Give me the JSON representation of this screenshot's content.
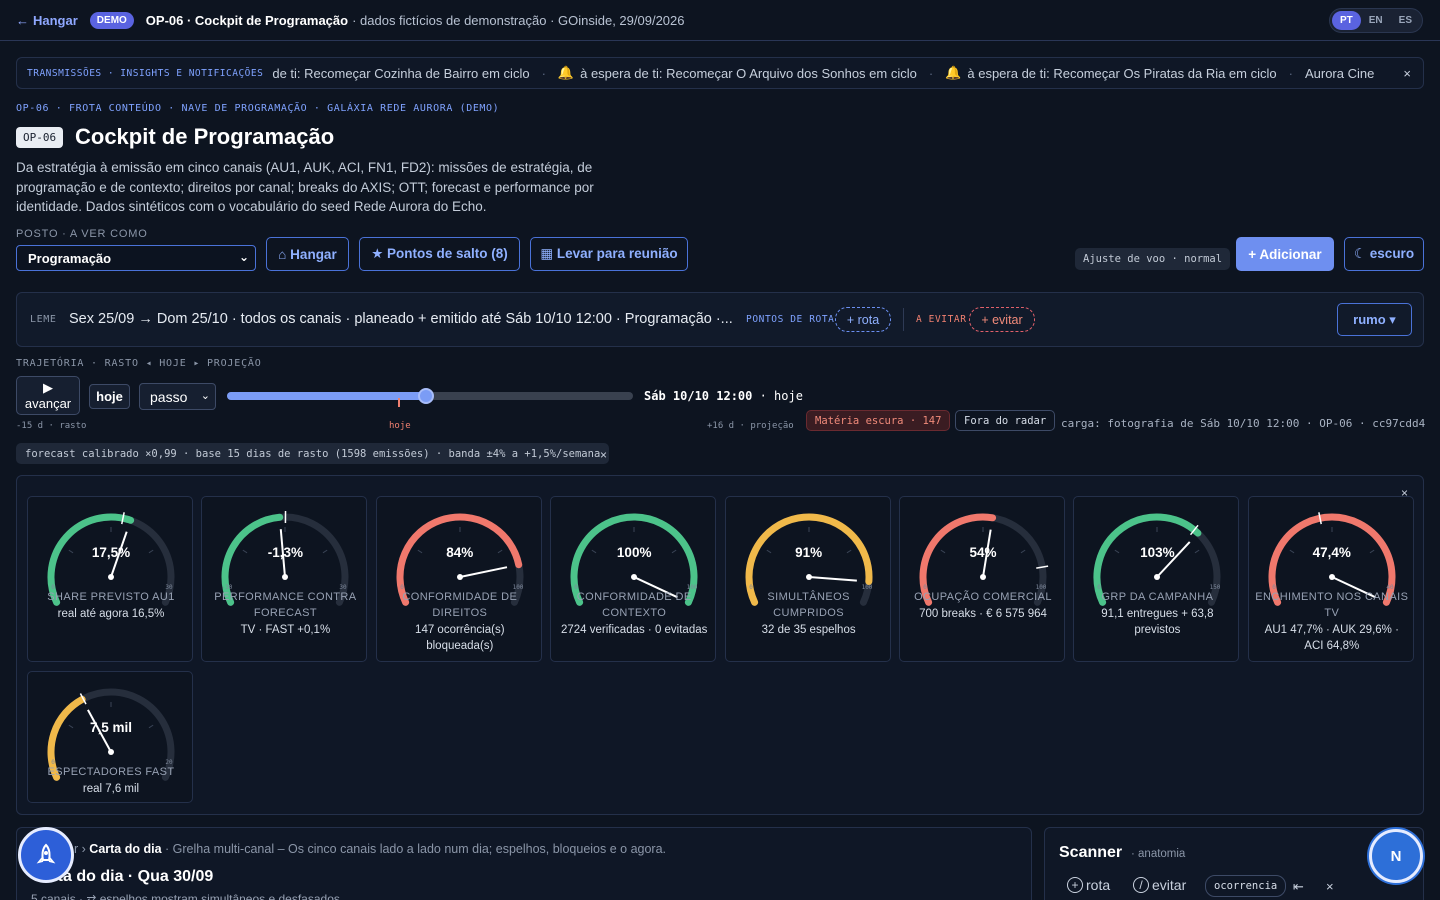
{
  "topbar": {
    "back_label": "Hangar",
    "demo_badge": "DEMO",
    "title": "OP-06 · Cockpit de Programação",
    "subtitle": "· dados fictícios de demonstração · GOinside, 29/09/2026",
    "languages": [
      "PT",
      "EN",
      "ES"
    ],
    "active_language": "PT"
  },
  "ticker": {
    "label": "TRANSMISSÕES · INSIGHTS E NOTIFICAÇÕES",
    "items": [
      "de ti: Recomeçar Cozinha de Bairro em ciclo",
      "à espera de ti: Recomeçar O Arquivo dos Sonhos em ciclo",
      "à espera de ti: Recomeçar Os Piratas da Ria em ciclo",
      "Aurora Cine"
    ],
    "close": "×"
  },
  "breadcrumb": "OP-06 · FROTA CONTEÚDO · NAVE DE PROGRAMAÇÃO · GALÁXIA REDE AURORA (DEMO)",
  "page": {
    "code": "OP-06",
    "title": "Cockpit de Programação",
    "description": "Da estratégia à emissão em cinco canais (AU1, AUK, ACI, FN1, FD2): missões de estratégia, de programação e de contexto; direitos por canal; breaks do AXIS; OTT; forecast e performance por identidade. Dados sintéticos com o vocabulário do seed Rede Aurora do Echo."
  },
  "posto": {
    "label": "POSTO · A VER COMO",
    "value": "Programação"
  },
  "actions": {
    "hangar": "⌂ Hangar",
    "jump_points": "★ Pontos de salto (8)",
    "meeting": "▦ Levar para reunião",
    "flight_adjust": "Ajuste de voo · normal",
    "add": "+ Adicionar",
    "theme": "☾ escuro"
  },
  "leme": {
    "label": "LEME",
    "text": "Sex 25/09 → Dom 25/10 · todos os canais · planeado + emitido até Sáb 10/10 12:00 · Programação ·...",
    "waypoints_label": "PONTOS DE ROTA",
    "add_route": "+ rota",
    "avoid_label": "A EVITAR",
    "add_avoid": "+ evitar",
    "heading": "rumo ▾"
  },
  "trajectory": {
    "label": "TRAJETÓRIA · RASTO ◂ HOJE ▸ PROJEÇÃO",
    "advance_icon": "▶",
    "advance": "avançar",
    "today_button": "hoje",
    "step": "passo",
    "slider_fraction": 0.49,
    "readout_time": "Sáb 10/10 12:00",
    "readout_suffix": "· hoje",
    "tick_left": "-15 d · rasto",
    "tick_today": "hoje",
    "tick_right": "+16 d · projeção",
    "dark_matter": "Matéria escura · 147",
    "off_radar": "Fora do radar",
    "load": "carga: fotografia de Sáb 10/10 12:00 · OP-06 · cc97cdd4",
    "forecast": "forecast calibrado ×0,99 · base 15 dias de rasto (1598 emissões) · banda ±4% a +1,5%/semana",
    "forecast_close": "×"
  },
  "gauges": [
    {
      "value": "17,5%",
      "label": "SHARE PREVISTO AU1",
      "sub": "real até agora 16,5%",
      "min": "0",
      "max": "30",
      "fraction": 0.583,
      "marker": 0.55,
      "color": "#4cc38a"
    },
    {
      "value": "-1,3%",
      "label": "PERFORMANCE CONTRA FORECAST",
      "sub": "TV · FAST +0,1%",
      "min": "-30",
      "max": "30",
      "fraction": 0.478,
      "marker": 0.502,
      "color": "#4cc38a"
    },
    {
      "value": "84%",
      "label": "CONFORMIDADE DE DIREITOS",
      "sub": "147 ocorrência(s) bloqueada(s)",
      "min": "0",
      "max": "100",
      "fraction": 0.84,
      "marker": null,
      "color": "#f0786c"
    },
    {
      "value": "100%",
      "label": "CONFORMIDADE DE CONTEXTO",
      "sub": "2724 verificadas · 0 evitadas",
      "min": "0",
      "max": "100",
      "fraction": 1.0,
      "marker": null,
      "color": "#4cc38a"
    },
    {
      "value": "91%",
      "label": "SIMULTÂNEOS CUMPRIDOS",
      "sub": "32 de 35 espelhos",
      "min": "0",
      "max": "100",
      "fraction": 0.91,
      "marker": null,
      "color": "#f0b94a"
    },
    {
      "value": "54%",
      "label": "OCUPAÇÃO COMERCIAL",
      "sub": "700 breaks · € 6 575 964",
      "min": "0",
      "max": "100",
      "fraction": 0.54,
      "marker": 0.85,
      "color": "#f0786c"
    },
    {
      "value": "103%",
      "label": "GRP DA CAMPANHA",
      "sub": "91,1 entregues + 63,8 previstos",
      "min": "0",
      "max": "150",
      "fraction": 0.687,
      "marker": 0.667,
      "color": "#4cc38a"
    },
    {
      "value": "47,4%",
      "label": "ENCHIMENTO NOS CANAIS TV",
      "sub": "AU1 47,7% · AUK 29,6% · ACI 64,8%",
      "min": "0",
      "max": "40",
      "fraction": 1.0,
      "marker": 0.45,
      "color": "#f0786c"
    },
    {
      "value": "7,5 mil",
      "label": "ESPECTADORES FAST",
      "sub": "real 7,6 mil",
      "min": "0",
      "max": "20",
      "fraction": 0.375,
      "marker": 0.38,
      "color": "#f0b94a"
    }
  ],
  "gauges_close": "×",
  "carta": {
    "crumb_prefix": "r ›",
    "crumb_bold": "Carta do dia",
    "crumb_rest": "· Grelha multi-canal – Os cinco canais lado a lado num dia; espelhos, bloqueios e o agora.",
    "title": "Carta do dia · Qua 30/09",
    "sub": "5 canais · ⇄ espelhos mostram simultâneos e desfasados"
  },
  "scanner": {
    "title": "Scanner",
    "sub": "· anatomia",
    "route": "rota",
    "avoid": "evitar",
    "chip": "ocorrencia",
    "collapse": "⇤",
    "close": "×"
  },
  "avatar": "N",
  "fab_icon": "rocket-icon"
}
